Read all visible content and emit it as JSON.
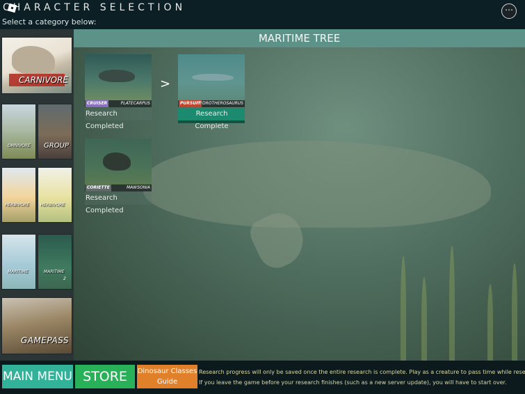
{
  "header": {
    "title": "CHARACTER SELECTION",
    "subtitle": "Select a category below:"
  },
  "sidebar": {
    "categories": [
      {
        "label": "CARNIVORE"
      },
      {
        "label": "OMNIVORE"
      },
      {
        "label": "GROUP"
      },
      {
        "label": "HERBIVORE"
      },
      {
        "label": "HERBIVORE"
      },
      {
        "label": "MARITIME"
      },
      {
        "label": "MARITIME",
        "suffix": "2"
      },
      {
        "label": "GAMEPASS"
      }
    ]
  },
  "tree": {
    "title": "MARITIME TREE",
    "arrow": ">",
    "nodes": [
      {
        "class": "CRUISER",
        "name": "PLATECARPUS",
        "status": "Research Completed"
      },
      {
        "class": "PURSUIT",
        "name": "HYDROTHEROSAURUS",
        "status": "Research Complete"
      },
      {
        "class": "CORIETTE",
        "name": "MAWSONIA",
        "status": "Research Completed"
      }
    ]
  },
  "footer": {
    "main_menu": "MAIN MENU",
    "store": "STORE",
    "guide_line1": "Dinosaur Classes",
    "guide_line2": "Guide",
    "notice_line1": "Research progress will only be saved once the entire research is complete. Play as a creature to pass time while researching.",
    "notice_line2": "If you leave the game before your research finishes (such as a new server update), you will have to start over."
  },
  "icons": {
    "menu": "more-options-icon",
    "game": "roblox-logo-icon"
  },
  "colors": {
    "header_bar": "#5d9288",
    "complete": "#1b8a6f",
    "main_menu": "#33b29a",
    "store": "#29b15a",
    "guide": "#e0802a"
  }
}
